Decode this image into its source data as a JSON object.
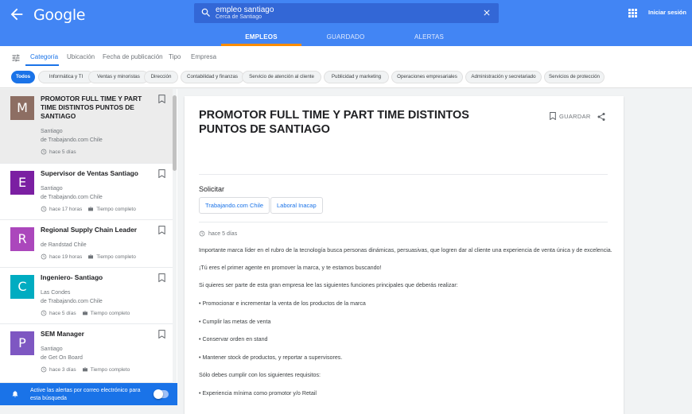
{
  "header": {
    "logo": "Google",
    "search_query": "empleo santiago",
    "search_location": "Cerca de Santiago",
    "signin": "Iniciar sesión",
    "tabs": [
      {
        "label": "EMPLEOS",
        "active": true
      },
      {
        "label": "GUARDADO",
        "active": false
      },
      {
        "label": "ALERTAS",
        "active": false
      }
    ]
  },
  "filters": {
    "tabs": [
      "Categoría",
      "Ubicación",
      "Fecha de publicación",
      "Tipo",
      "Empresa"
    ],
    "chips": [
      "Todos",
      "Informática y TI",
      "Ventas y minoristas",
      "Dirección",
      "Contabilidad y finanzas",
      "Servicio de atención al cliente",
      "Publicidad y marketing",
      "Operaciones empresariales",
      "Administración y secretariado",
      "Servicios de protección"
    ]
  },
  "jobs": [
    {
      "letter": "M",
      "color": "#8d6e63",
      "title": "PROMOTOR FULL TIME Y PART TIME DISTINTOS PUNTOS DE SANTIAGO",
      "location": "Santiago",
      "source": "de Trabajando.com Chile",
      "age": "hace 5 días",
      "type": ""
    },
    {
      "letter": "E",
      "color": "#7b1fa2",
      "title": "Supervisor de Ventas Santiago",
      "location": "Santiago",
      "source": "de Trabajando.com Chile",
      "age": "hace 17 horas",
      "type": "Tiempo completo"
    },
    {
      "letter": "R",
      "color": "#ab47bc",
      "title": "Regional Supply Chain Leader",
      "location": "",
      "source": "de Randstad Chile",
      "age": "hace 19 horas",
      "type": "Tiempo completo"
    },
    {
      "letter": "C",
      "color": "#00acc1",
      "title": "Ingeniero- Santiago",
      "location": "Las Condes",
      "source": "de Trabajando.com Chile",
      "age": "hace 5 días",
      "type": "Tiempo completo"
    },
    {
      "letter": "P",
      "color": "#7e57c2",
      "title": "SEM Manager",
      "location": "Santiago",
      "source": "de Get On Board",
      "age": "hace 3 días",
      "type": "Tiempo completo"
    }
  ],
  "alert": {
    "text": "Active las alertas por correo electrónico para esta búsqueda"
  },
  "detail": {
    "title": "PROMOTOR FULL TIME Y PART TIME DISTINTOS PUNTOS DE SANTIAGO",
    "save_label": "GUARDAR",
    "apply_heading": "Solicitar",
    "apply_options": [
      "Trabajando.com Chile",
      "Laboral Inacap"
    ],
    "posted": "hace 5 días",
    "description": [
      "Importante marca líder en el rubro de la tecnología busca personas dinámicas, persuasivas, que logren dar al cliente una experiencia de venta única y de excelencia.",
      "¡Tú eres el primer agente en promover la marca, y te estamos buscando!",
      "Si quieres ser parte de esta gran empresa lee las siguientes funciones principales que deberás realizar:",
      "• Promocionar e incrementar la venta de los productos de la marca",
      "• Cumplir las metas de venta",
      "• Conservar orden en stand",
      "• Mantener stock de productos, y reportar a supervisores.",
      "Sólo debes cumplir con los siguientes requisitos:",
      "• Experiencia mínima como promotor y/o Retail"
    ]
  }
}
